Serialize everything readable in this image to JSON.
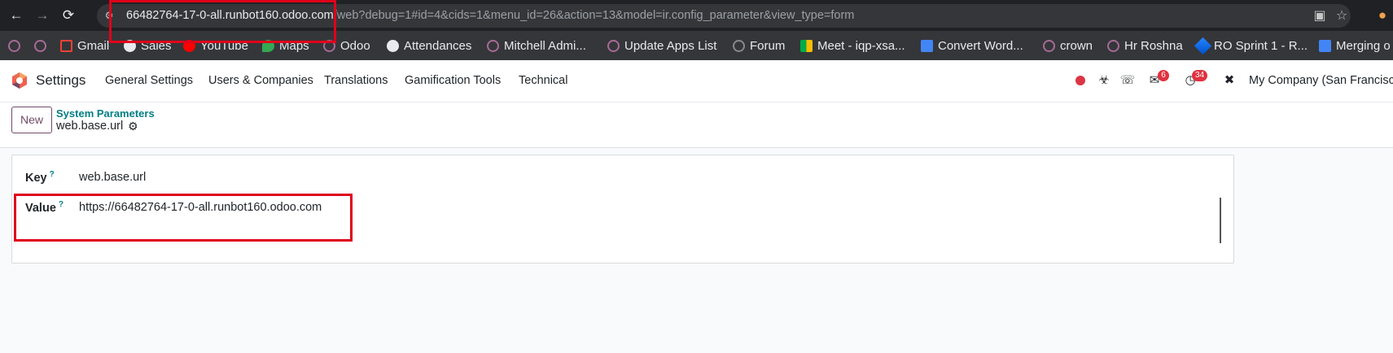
{
  "browser": {
    "url_host": "66482764-17-0-all.runbot160.odoo.com",
    "url_path": "/web?debug=1#id=4&cids=1&menu_id=26&action=13&model=ir.config_parameter&view_type=form",
    "icons": [
      "back-icon",
      "forward-icon",
      "reload-icon",
      "site-settings-icon",
      "install-app-icon",
      "star-icon",
      "profile-icon"
    ]
  },
  "bookmarks": [
    {
      "label": ""
    },
    {
      "label": ""
    },
    {
      "label": "Gmail"
    },
    {
      "label": "Sales"
    },
    {
      "label": "YouTube"
    },
    {
      "label": "Maps"
    },
    {
      "label": "Odoo"
    },
    {
      "label": "Attendances"
    },
    {
      "label": "Mitchell Admi..."
    },
    {
      "label": "Update Apps List"
    },
    {
      "label": "Forum"
    },
    {
      "label": "Meet - iqp-xsa..."
    },
    {
      "label": "Convert Word..."
    },
    {
      "label": "crown"
    },
    {
      "label": "Hr Roshna"
    },
    {
      "label": "RO Sprint 1 - R..."
    },
    {
      "label": "Merging o"
    }
  ],
  "navbar": {
    "app_name": "Settings",
    "menus": [
      "General Settings",
      "Users & Companies",
      "Translations",
      "Gamification Tools",
      "Technical"
    ],
    "messages_count": "6",
    "activities_count": "34",
    "company": "My Company (San Francisco)"
  },
  "control_panel": {
    "new_label": "New",
    "breadcrumb_parent": "System Parameters",
    "breadcrumb_current": "web.base.url"
  },
  "form": {
    "key_label": "Key",
    "key_tooltip": "?",
    "key_value": "web.base.url",
    "value_label": "Value",
    "value_tooltip": "?",
    "value_value": "https://66482764-17-0-all.runbot160.odoo.com"
  },
  "colors": {
    "highlight": "#e0001a",
    "odoo_primary": "#714b67",
    "odoo_link": "#017e84",
    "badge": "#e0313f"
  }
}
